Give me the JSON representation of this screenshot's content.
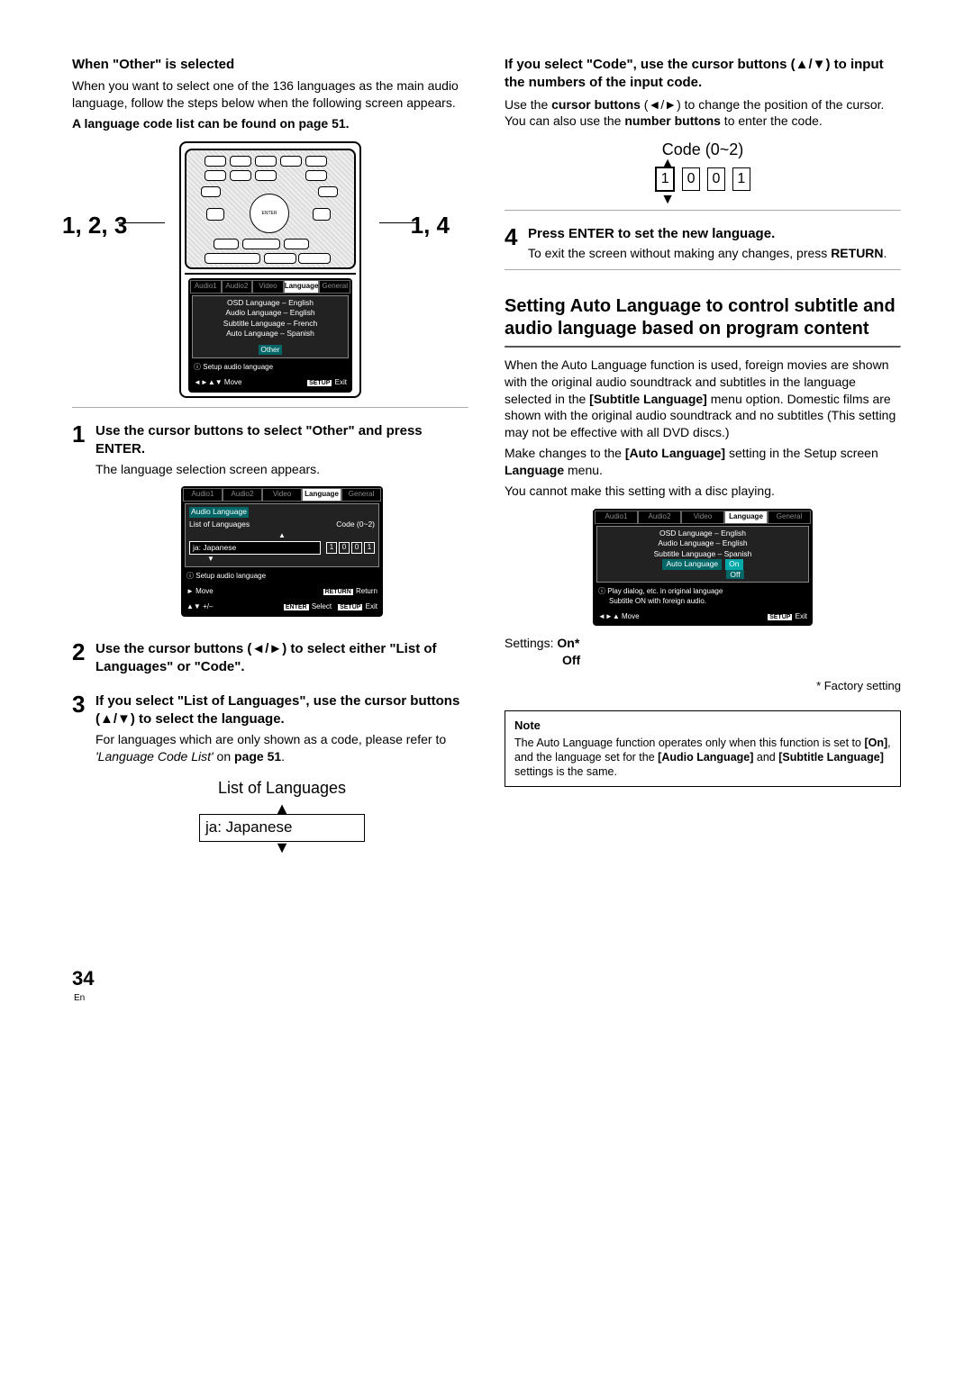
{
  "left": {
    "h_when_other": "When \"Other\" is selected",
    "when_other_p": "When you want to select one of the 136 languages as the main audio language, follow the steps below when the following screen appears.",
    "code_list_note": "A language code list can be found on page 51.",
    "callout_left": "1, 2, 3",
    "callout_right": "1, 4",
    "remote_btn_enter": "ENTER",
    "remote_osd": {
      "tabs": [
        "Audio1",
        "Audio2",
        "Video",
        "Language",
        "General"
      ],
      "l1": "OSD Language – English",
      "l2": "Audio Language – English",
      "l3": "Subtitle Language – French",
      "l4": "Auto Language – Spanish",
      "l5": "Other",
      "info": "Setup audio language",
      "move": "Move",
      "exit": "Exit",
      "setup": "SETUP"
    },
    "step1_title": "Use the cursor buttons to select \"Other\" and press ENTER.",
    "step1_body": "The language selection screen appears.",
    "osd2": {
      "tabs": [
        "Audio1",
        "Audio2",
        "Video",
        "Language",
        "General"
      ],
      "sect": "Audio Language",
      "listof": "List of Languages",
      "code": "Code (0~2)",
      "jap": "ja: Japanese",
      "d1": "1",
      "d2": "0",
      "d3": "0",
      "d4": "1",
      "info": "Setup audio language",
      "move": "Move",
      "pm": "+/–",
      "ret": "Return",
      "retb": "RETURN",
      "sel": "Select",
      "ent": "ENTER",
      "exit": "Exit",
      "setup": "SETUP"
    },
    "step2_title": "Use the cursor buttons (◄/►) to select either \"List of Languages\" or \"Code\".",
    "step3_title": "If you select \"List of Languages\", use the cursor buttons (▲/▼) to select the language.",
    "step3_body1": "For languages which are only shown as a code, please refer to ",
    "step3_body_em": "'Language Code List'",
    "step3_body2": " on ",
    "step3_body_pg": "page 51",
    "step3_body3": ".",
    "listfig_label": "List of Languages",
    "listfig_value": "ja: Japanese"
  },
  "right": {
    "h_code": "If you select \"Code\", use the cursor buttons (▲/▼) to input the numbers of the input code.",
    "code_p1a": "Use the ",
    "code_p1b": "cursor buttons",
    "code_p1c": " (◄/►) to change the position of the cursor. You can also use the ",
    "code_p1d": "number buttons",
    "code_p1e": " to enter the code.",
    "codefig_label": "Code (0~2)",
    "codefig_d1": "1",
    "codefig_d2": "0",
    "codefig_d3": "0",
    "codefig_d4": "1",
    "step4_title": "Press ENTER to set the new language.",
    "step4_body1": "To exit the screen without making any changes, press ",
    "step4_body2": "RETURN",
    "step4_body3": ".",
    "h_autolang": "Setting Auto Language to control subtitle and audio language based on program content",
    "autolang_p1": "When the Auto Language function is used, foreign movies are shown with the original audio soundtrack and subtitles in the language selected in the ",
    "autolang_b1": "[Subtitle Language]",
    "autolang_p2": " menu option. Domestic films are shown with the original audio soundtrack and no subtitles (This setting may not be effective with all DVD discs.)",
    "autolang_p3": "Make changes to the ",
    "autolang_b2": "[Auto Language]",
    "autolang_p4": " setting in the Setup screen ",
    "autolang_b3": "Language",
    "autolang_p5": " menu.",
    "autolang_p6": "You cannot make this setting with a disc playing.",
    "osd3": {
      "tabs": [
        "Audio1",
        "Audio2",
        "Video",
        "Language",
        "General"
      ],
      "l1": "OSD Language – English",
      "l2": "Audio Language – English",
      "l3": "Subtitle Language – Spanish",
      "l4": "Auto Language",
      "on": "On",
      "off": "Off",
      "info1": "Play dialog, etc. in original language",
      "info2": "Subtitle ON with foreign audio.",
      "move": "Move",
      "exit": "Exit",
      "setup": "SETUP"
    },
    "settings_label": "Settings: ",
    "settings_on": "On*",
    "settings_off": "Off",
    "factory": "* Factory setting",
    "note_title": "Note",
    "note_p1": "The Auto Language function operates only when this function is set to ",
    "note_b1": "[On]",
    "note_p2": ", and the language set for the ",
    "note_b2": "[Audio Language]",
    "note_p3": " and ",
    "note_b3": "[Subtitle Language]",
    "note_p4": " settings is the same."
  },
  "footer": {
    "page": "34",
    "en": "En"
  }
}
